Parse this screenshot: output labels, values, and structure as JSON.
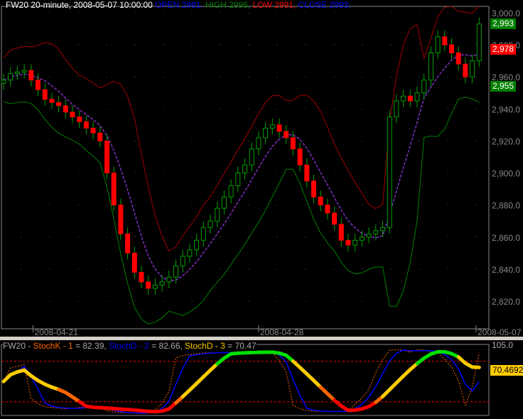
{
  "header": {
    "symbol_period": "FW20 20-minute, 2008-05-07 10:00:00",
    "open": "OPEN 2991,",
    "high": "HIGH 2995,",
    "low": "LOW 2991,",
    "close": "CLOSE 2993,"
  },
  "price_tags": [
    {
      "text": "2,993",
      "color": "#008000",
      "value": 2993
    },
    {
      "text": "2,978",
      "color": "#ff0000",
      "value": 2978
    },
    {
      "text": "2,955",
      "color": "#008000",
      "value": 2955
    }
  ],
  "stoch_header": {
    "prefix": "FW20 - ",
    "k": "StochK - 1",
    "k_val": " = 82.39, ",
    "d": "StochD - 2",
    "d_val": " = 82.66, ",
    "d3": "StochD - 3",
    "d3_val": " = 70.47"
  },
  "stoch_tag": "70.4692",
  "chart_data": [
    {
      "type": "candlestick",
      "title": "FW20 20-minute",
      "ylim": [
        2810,
        3005
      ],
      "yticks": [
        "3,000.0",
        "2,980.0",
        "2,960.0",
        "2,940.0",
        "2,920.0",
        "2,900.0",
        "2,880.0",
        "2,860.0",
        "2,840.0",
        "2,820.0"
      ],
      "ytick_values": [
        3000,
        2980,
        2960,
        2940,
        2920,
        2900,
        2880,
        2860,
        2840,
        2820
      ],
      "xticks": [
        "2008-04-21",
        "2008-04-28",
        "2008-05-07"
      ],
      "xtick_bars": [
        5,
        37,
        69
      ],
      "closes": [
        2958,
        2962,
        2963,
        2964,
        2958,
        2952,
        2946,
        2944,
        2942,
        2938,
        2935,
        2932,
        2928,
        2925,
        2920,
        2900,
        2880,
        2862,
        2850,
        2838,
        2832,
        2828,
        2830,
        2832,
        2835,
        2842,
        2848,
        2852,
        2858,
        2866,
        2870,
        2878,
        2885,
        2892,
        2900,
        2905,
        2915,
        2922,
        2928,
        2930,
        2926,
        2922,
        2915,
        2905,
        2895,
        2885,
        2880,
        2875,
        2868,
        2858,
        2855,
        2858,
        2860,
        2862,
        2864,
        2866,
        2935,
        2945,
        2948,
        2945,
        2950,
        2958,
        2975,
        2985,
        2980,
        2975,
        2968,
        2960,
        2970,
        2993
      ],
      "overlays": [
        "moving average (purple dashed)",
        "upper band (dark red)",
        "lower band (green)"
      ]
    },
    {
      "type": "line",
      "title": "Stochastic",
      "ylim": [
        0,
        105
      ],
      "levels": [
        80,
        20
      ],
      "ytick": "105.0",
      "series": [
        {
          "name": "StochK - 1",
          "last": 82.39,
          "color": "#ff6600"
        },
        {
          "name": "StochD - 2",
          "last": 82.66,
          "color": "#0000ff"
        },
        {
          "name": "StochD - 3",
          "last": 70.47,
          "color": "#ffcc00"
        }
      ]
    }
  ]
}
